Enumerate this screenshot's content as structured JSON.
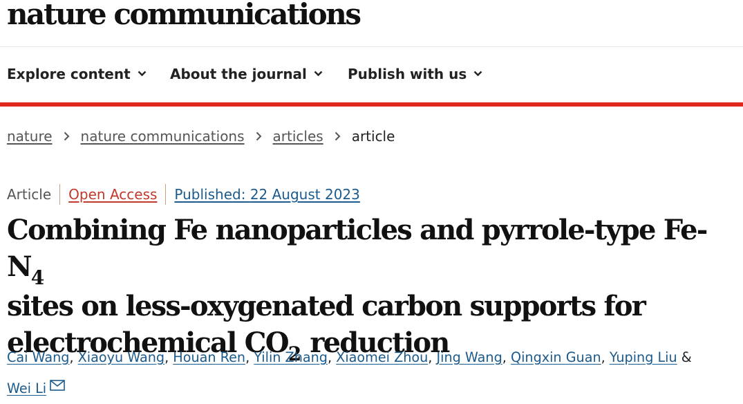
{
  "brand": {
    "name": "nature communications"
  },
  "nav": {
    "items": [
      {
        "label": "Explore content"
      },
      {
        "label": "About the journal"
      },
      {
        "label": "Publish with us"
      }
    ]
  },
  "breadcrumb": {
    "items": [
      "nature",
      "nature communications",
      "articles"
    ],
    "current": "article"
  },
  "meta": {
    "type": "Article",
    "access": "Open Access",
    "published_label": "Published:",
    "published_date": "22 August 2023"
  },
  "title": {
    "line1_a": "Combining Fe nanoparticles and pyrrole-type Fe-N",
    "line1_sub": "4",
    "line2": "sites on less-oxygenated carbon supports for",
    "line3_a": "electrochemical CO",
    "line3_sub": "2",
    "line3_b": " reduction"
  },
  "authors": {
    "list": [
      "Cai Wang",
      "Xiaoyu Wang",
      "Houan Ren",
      "Yilin Zhang",
      "Xiaomei Zhou",
      "Jing Wang",
      "Qingxin Guan",
      "Yuping Liu"
    ],
    "conjunction": "&",
    "last": "Wei Li"
  },
  "icons": {
    "chevron": "chevron-down-icon",
    "separator": "chevron-right-icon",
    "mail": "envelope-icon"
  },
  "colors": {
    "accent_red": "#e0281e",
    "link_blue": "#1b5a8c",
    "open_access": "#c0392b"
  }
}
